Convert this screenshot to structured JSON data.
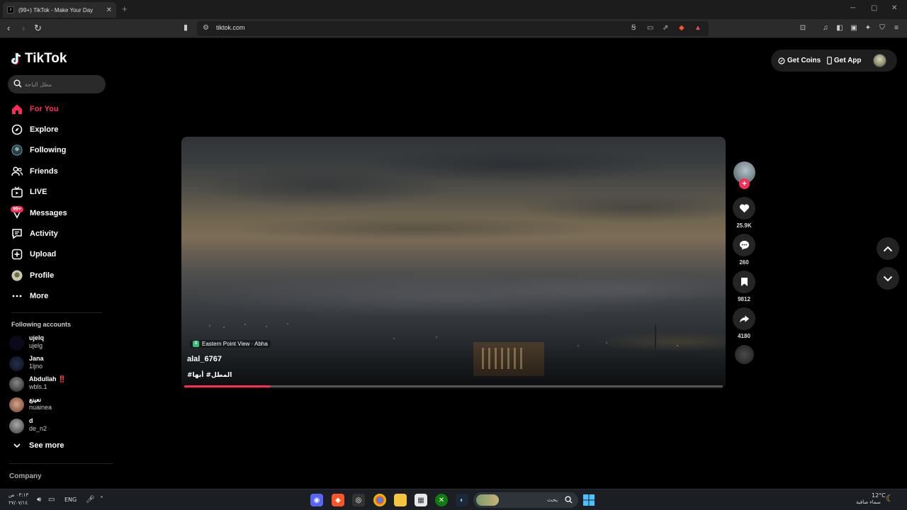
{
  "browser": {
    "tab_title": "(99+) TikTok - Make Your Day",
    "new_tab": "+",
    "url": "tiktok.com",
    "window_controls": [
      "─",
      "▢",
      "✕"
    ]
  },
  "sidebar": {
    "logo_text": "TikTok",
    "search_placeholder": "مطل الباحة",
    "nav": [
      {
        "label": "For You",
        "icon": "home-icon",
        "active": true
      },
      {
        "label": "Explore",
        "icon": "compass-icon"
      },
      {
        "label": "Following",
        "icon": "following-avatar-icon"
      },
      {
        "label": "Friends",
        "icon": "friends-icon"
      },
      {
        "label": "LIVE",
        "icon": "live-tv-icon"
      },
      {
        "label": "Messages",
        "icon": "messages-icon",
        "badge": "99+"
      },
      {
        "label": "Activity",
        "icon": "activity-icon"
      },
      {
        "label": "Upload",
        "icon": "upload-icon"
      },
      {
        "label": "Profile",
        "icon": "profile-avatar-icon"
      },
      {
        "label": "More",
        "icon": "more-icon"
      }
    ],
    "following_header": "Following accounts",
    "accounts": [
      {
        "name": "ujelq",
        "handle": "ujelg"
      },
      {
        "name": "Jana",
        "handle": "1ljno"
      },
      {
        "name": "Abdullah ‼️",
        "handle": "wbls.1"
      },
      {
        "name": "نعينع",
        "handle": "nuainea"
      },
      {
        "name": "d",
        "handle": "de_n2"
      }
    ],
    "see_more": "See more",
    "company": "Company"
  },
  "top_right": {
    "get_coins": "Get Coins",
    "get_app": "Get App"
  },
  "video": {
    "location": "Eastern Point View · Abha",
    "username": "alal_6767",
    "tags": "#المطل# أبها",
    "progress_fraction": 0.16
  },
  "actions": {
    "likes": "25.9K",
    "comments": "260",
    "saves": "9812",
    "shares": "4180"
  },
  "taskbar": {
    "search_text": "بحث",
    "lang": "ENG",
    "time": "٠٣:١٣ ص",
    "date": "٢٧/٠٧/١٤",
    "temperature": "12°C",
    "weather": "سماء صافية"
  },
  "colors": {
    "accent": "#fe2c55",
    "background": "#000000",
    "chrome": "#2b2b2b"
  }
}
